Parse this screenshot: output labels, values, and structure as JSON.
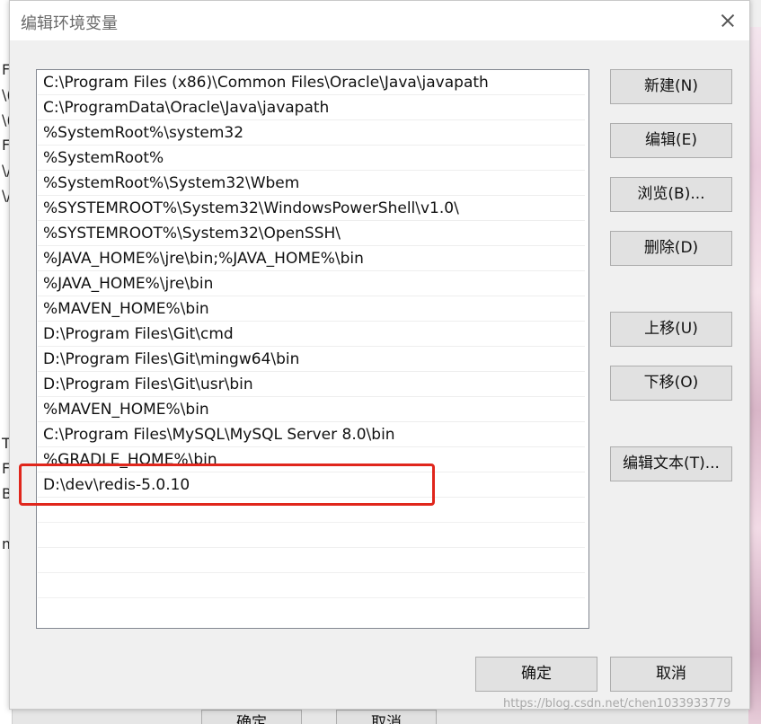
{
  "dialog": {
    "title": "编辑环境变量"
  },
  "paths": [
    "C:\\Program Files (x86)\\Common Files\\Oracle\\Java\\javapath",
    "C:\\ProgramData\\Oracle\\Java\\javapath",
    "%SystemRoot%\\system32",
    "%SystemRoot%",
    "%SystemRoot%\\System32\\Wbem",
    "%SYSTEMROOT%\\System32\\WindowsPowerShell\\v1.0\\",
    "%SYSTEMROOT%\\System32\\OpenSSH\\",
    "%JAVA_HOME%\\jre\\bin;%JAVA_HOME%\\bin",
    "%JAVA_HOME%\\jre\\bin",
    "%MAVEN_HOME%\\bin",
    "D:\\Program Files\\Git\\cmd",
    "D:\\Program Files\\Git\\mingw64\\bin",
    "D:\\Program Files\\Git\\usr\\bin",
    "%MAVEN_HOME%\\bin",
    "C:\\Program Files\\MySQL\\MySQL Server 8.0\\bin",
    "%GRADLE_HOME%\\bin",
    "D:\\dev\\redis-5.0.10"
  ],
  "buttons": {
    "new": "新建(N)",
    "edit": "编辑(E)",
    "browse": "浏览(B)...",
    "delete": "删除(D)",
    "move_up": "上移(U)",
    "move_down": "下移(O)",
    "edit_text": "编辑文本(T)...",
    "ok": "确定",
    "cancel": "取消"
  },
  "background": {
    "left_fragments": [
      "F",
      "\\(",
      "\\(",
      "F",
      "\\/",
      "\\/",
      "T",
      "F",
      "B",
      "m"
    ],
    "ok": "确定",
    "cancel": "取消"
  },
  "watermark": "https://blog.csdn.net/chen1033933779"
}
